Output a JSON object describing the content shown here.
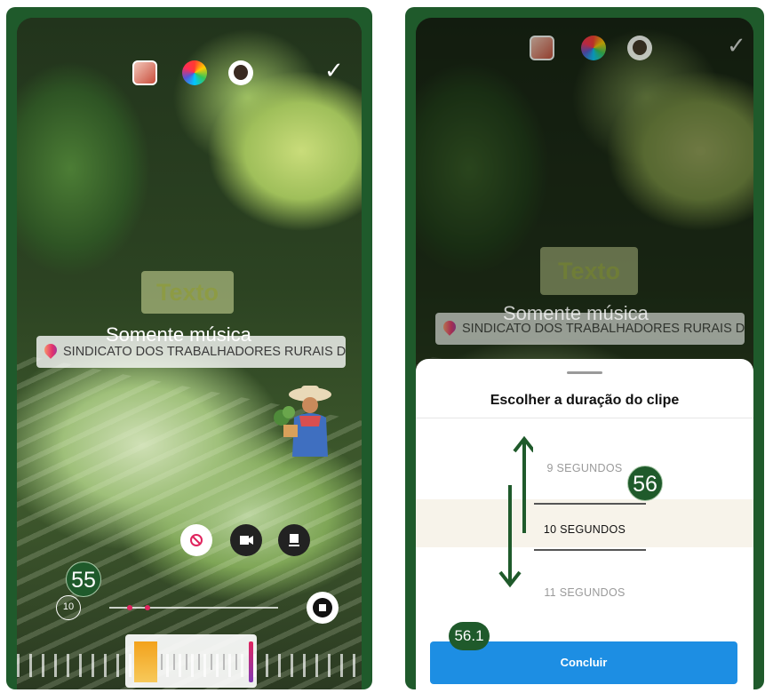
{
  "left_screen": {
    "top_icons": [
      "sticker-icon",
      "color-wheel-icon",
      "avatar-effect-icon",
      "checkmark-icon"
    ],
    "text_sticker": "Texto",
    "music_label": "Somente música",
    "location_sticker": "SINDICATO DOS TRABALHADORES RURAIS DE...",
    "timer_label": "10",
    "controls": [
      "no-music-icon",
      "video-icon",
      "stop-icon"
    ],
    "step_marker": "55"
  },
  "right_screen": {
    "text_sticker": "Texto",
    "music_label": "Somente música",
    "location_sticker": "SINDICATO DOS TRABALHADORES RURAIS DE...",
    "sheet": {
      "title": "Escolher a duração do clipe",
      "options": [
        "9 SEGUNDOS",
        "10 SEGUNDOS",
        "11 SEGUNDOS"
      ],
      "selected": "10 SEGUNDOS",
      "confirm_label": "Concluir"
    },
    "step_marker": "56",
    "step_marker_sub": "56.1"
  },
  "colors": {
    "frame": "#1f5a2b",
    "button": "#1d8ee3",
    "marker": "#1f5a2b"
  }
}
